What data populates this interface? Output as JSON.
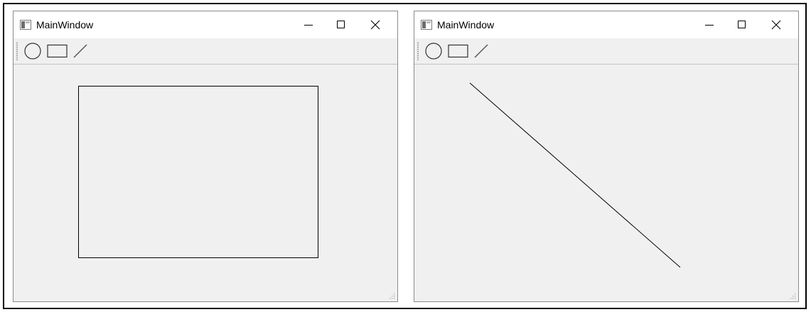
{
  "windows": [
    {
      "title": "MainWindow",
      "tools": [
        {
          "name": "ellipse-tool",
          "icon": "circle-icon"
        },
        {
          "name": "rectangle-tool",
          "icon": "rectangle-icon"
        },
        {
          "name": "line-tool",
          "icon": "line-icon"
        }
      ],
      "drawn_shape": "rectangle"
    },
    {
      "title": "MainWindow",
      "tools": [
        {
          "name": "ellipse-tool",
          "icon": "circle-icon"
        },
        {
          "name": "rectangle-tool",
          "icon": "rectangle-icon"
        },
        {
          "name": "line-tool",
          "icon": "line-icon"
        }
      ],
      "drawn_shape": "line"
    }
  ],
  "colors": {
    "canvas_background": "#f0f0f0",
    "titlebar_background": "#ffffff",
    "stroke": "#000000"
  }
}
